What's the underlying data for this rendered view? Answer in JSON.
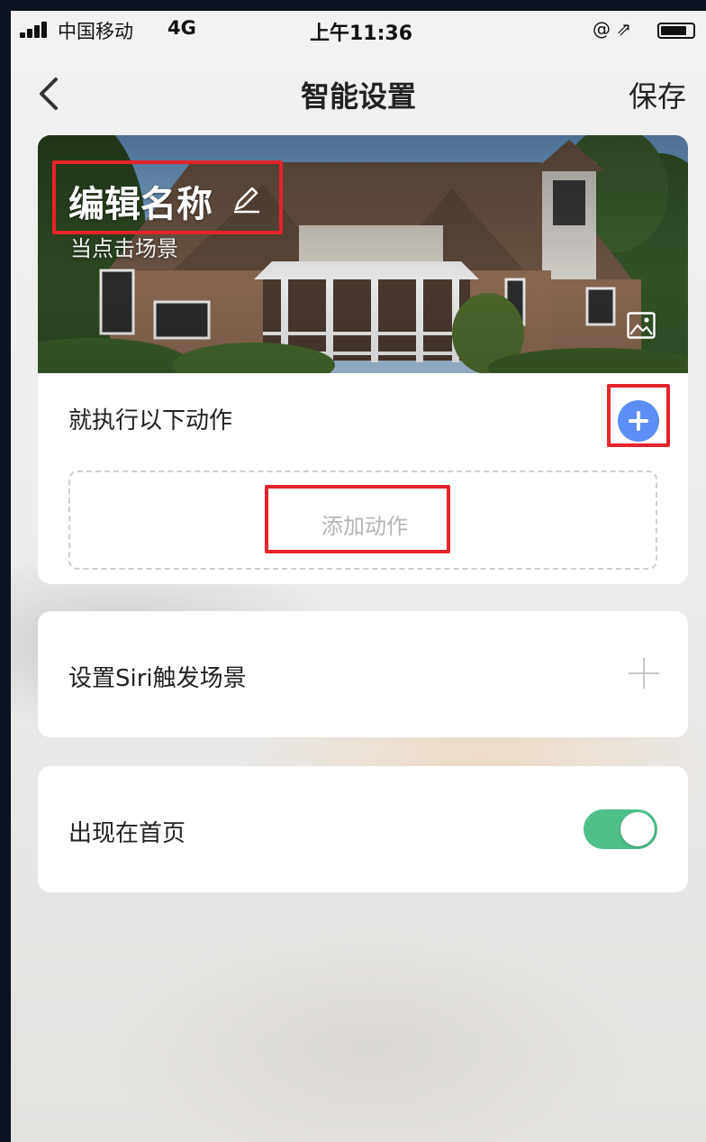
{
  "status_bar": {
    "carrier": "中国移动",
    "network": "4G",
    "time": "上午11:36",
    "icons": [
      "signal-icon",
      "lock-rotation-icon",
      "location-icon",
      "battery-icon"
    ],
    "status_glyphs": "@ ⇗"
  },
  "nav": {
    "title": "智能设置",
    "save_label": "保存",
    "back_icon": "chevron-left-icon"
  },
  "scene": {
    "name": "编辑名称",
    "subtitle": "当点击场景",
    "edit_icon": "pencil-icon",
    "background_icon": "image-icon"
  },
  "actions": {
    "label": "就执行以下动作",
    "add_action_text": "添加动作",
    "add_icon": "plus-circle-icon"
  },
  "siri": {
    "label": "设置Siri触发场景",
    "add_icon": "plus-icon"
  },
  "home": {
    "label": "出现在首页",
    "toggle_on": true
  },
  "colors": {
    "accent_blue": "#5c8ff5",
    "toggle_green": "#4fc08a",
    "highlight_red": "#e5232b"
  }
}
